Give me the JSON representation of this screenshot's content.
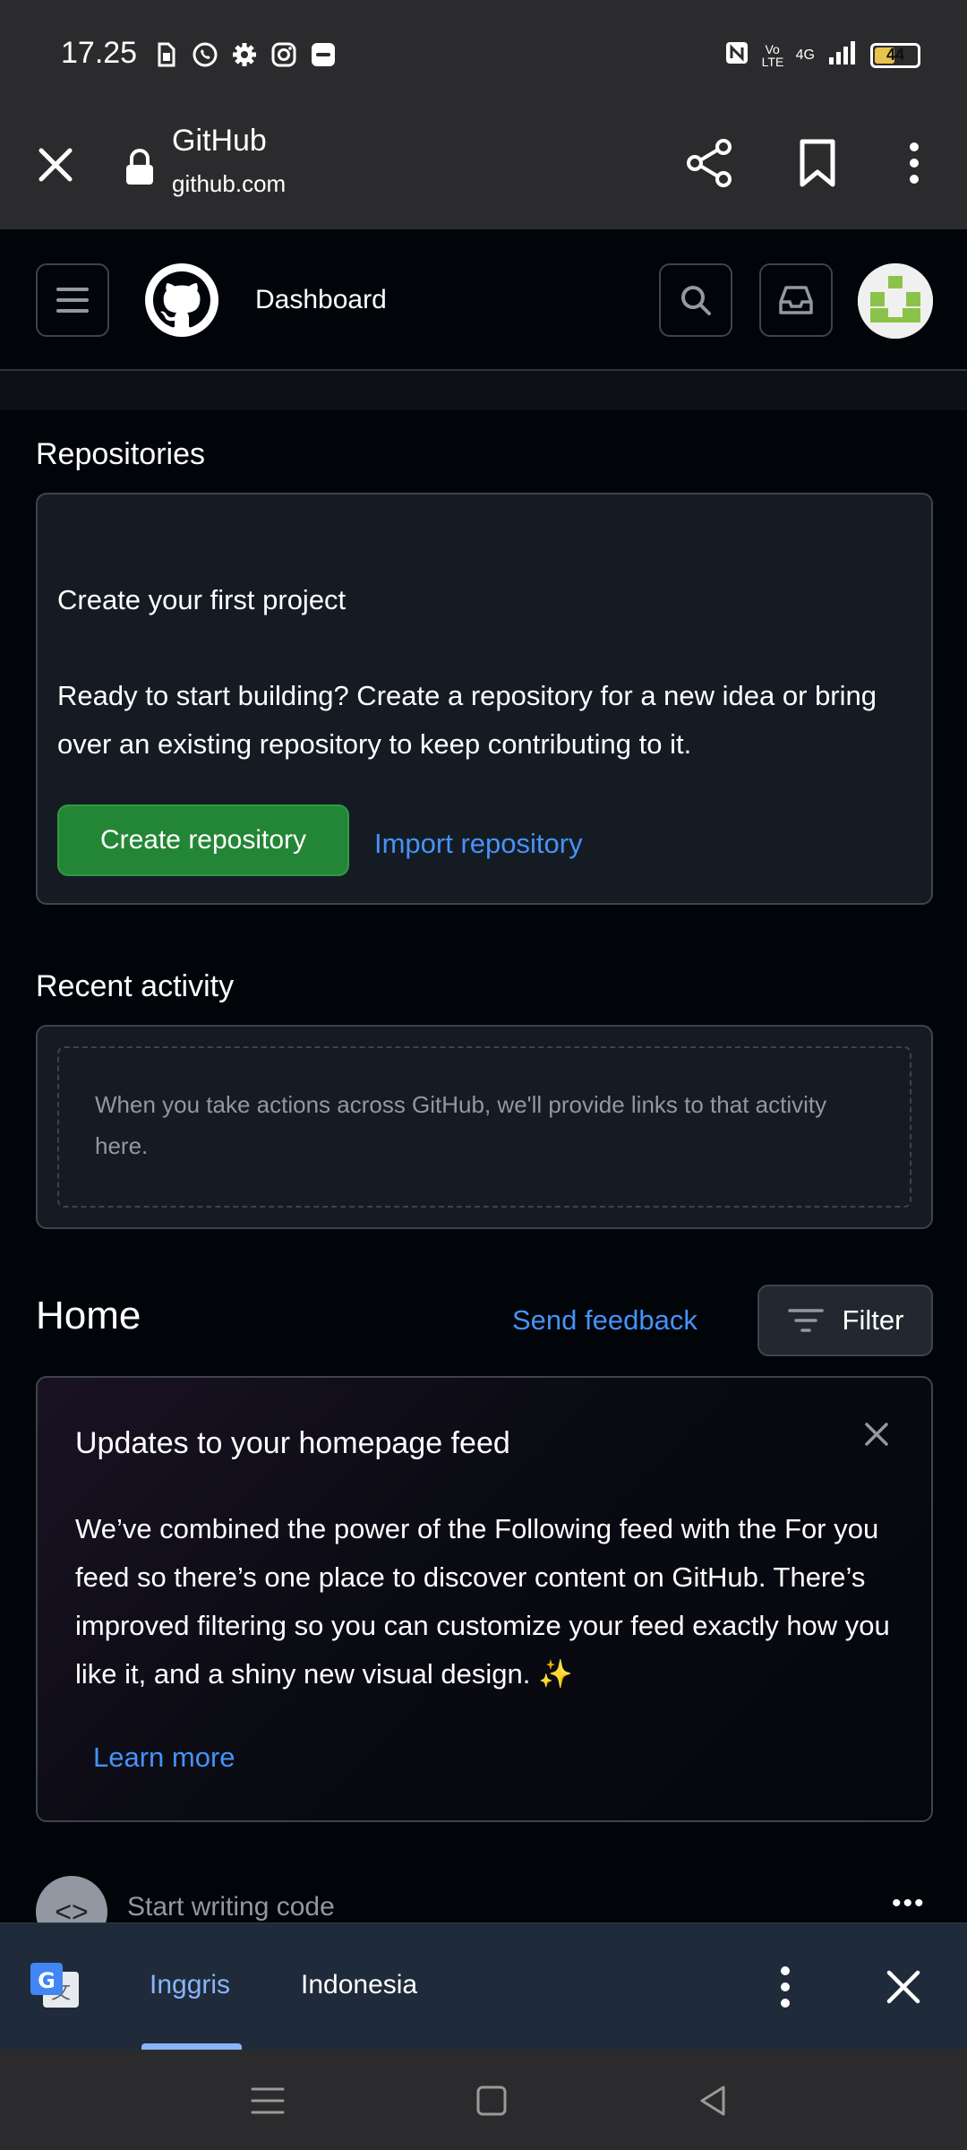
{
  "status_bar": {
    "time": "17.25",
    "battery": "44",
    "network": "4G",
    "volte": "Vo LTE"
  },
  "browser": {
    "title": "GitHub",
    "url": "github.com"
  },
  "header": {
    "title": "Dashboard"
  },
  "repositories": {
    "section_title": "Repositories",
    "heading": "Create your first project",
    "body": "Ready to start building? Create a repository for a new idea or bring over an existing repository to keep contributing to it.",
    "create_label": "Create repository",
    "import_label": "Import repository"
  },
  "recent_activity": {
    "section_title": "Recent activity",
    "empty_text": "When you take actions across GitHub, we'll provide links to that activity here."
  },
  "home": {
    "title": "Home",
    "send_feedback": "Send feedback",
    "filter_label": "Filter"
  },
  "feed_notice": {
    "title": "Updates to your homepage feed",
    "body": "We’ve combined the power of the Following feed with the For you feed so there’s one place to discover content on GitHub. There’s improved filtering so you can customize your feed exactly how you like it, and a shiny new visual design. ✨",
    "learn_more": "Learn more"
  },
  "start_writing": {
    "label": "Start writing code"
  },
  "translate_bar": {
    "lang_from": "Inggris",
    "lang_to": "Indonesia"
  },
  "colors": {
    "accent_green": "#238636",
    "link_blue": "#4493f8",
    "background": "#010409",
    "card": "#151b23"
  }
}
